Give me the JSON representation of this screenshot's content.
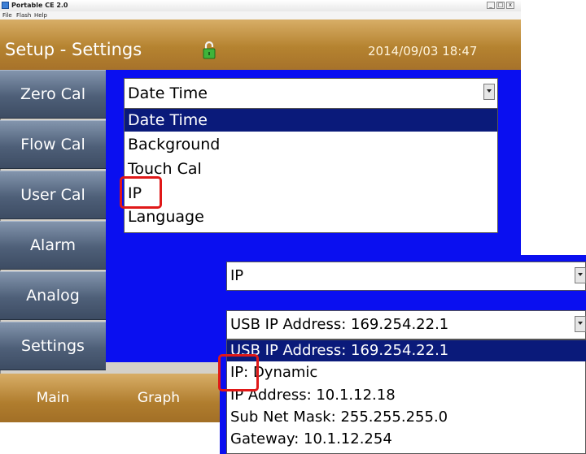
{
  "window": {
    "title": "Portable CE 2.0",
    "menu": [
      "File",
      "Flash",
      "Help"
    ],
    "controls": {
      "minimize": "_",
      "maximize": "□",
      "close": "x"
    }
  },
  "header": {
    "title": "Setup - Settings",
    "datetime": "2014/09/03 18:47",
    "lock_icon": "lock-icon"
  },
  "sidebar": {
    "items": [
      {
        "label": "Zero Cal"
      },
      {
        "label": "Flow Cal"
      },
      {
        "label": "User Cal"
      },
      {
        "label": "Alarm"
      },
      {
        "label": "Analog"
      },
      {
        "label": "Settings"
      }
    ]
  },
  "bottom_nav": {
    "items": [
      {
        "label": "Main"
      },
      {
        "label": "Graph"
      }
    ]
  },
  "settings_dropdown": {
    "selected": "Date Time",
    "options": [
      "Date Time",
      "Background",
      "Touch Cal",
      "IP",
      "Language"
    ],
    "highlighted": "Date Time"
  },
  "ip_panel": {
    "category": "IP",
    "selected": "USB IP Address: 169.254.22.1",
    "options": [
      "USB IP Address: 169.254.22.1",
      "IP: Dynamic",
      "IP Address: 10.1.12.18",
      "Sub Net Mask: 255.255.255.0",
      "Gateway: 10.1.12.254"
    ],
    "highlighted": "USB IP Address: 169.254.22.1"
  },
  "colors": {
    "header_gold": "#b58330",
    "panel_blue": "#0a0ff0",
    "selection_navy": "#0a1a7a",
    "highlight_red": "#e01818"
  }
}
